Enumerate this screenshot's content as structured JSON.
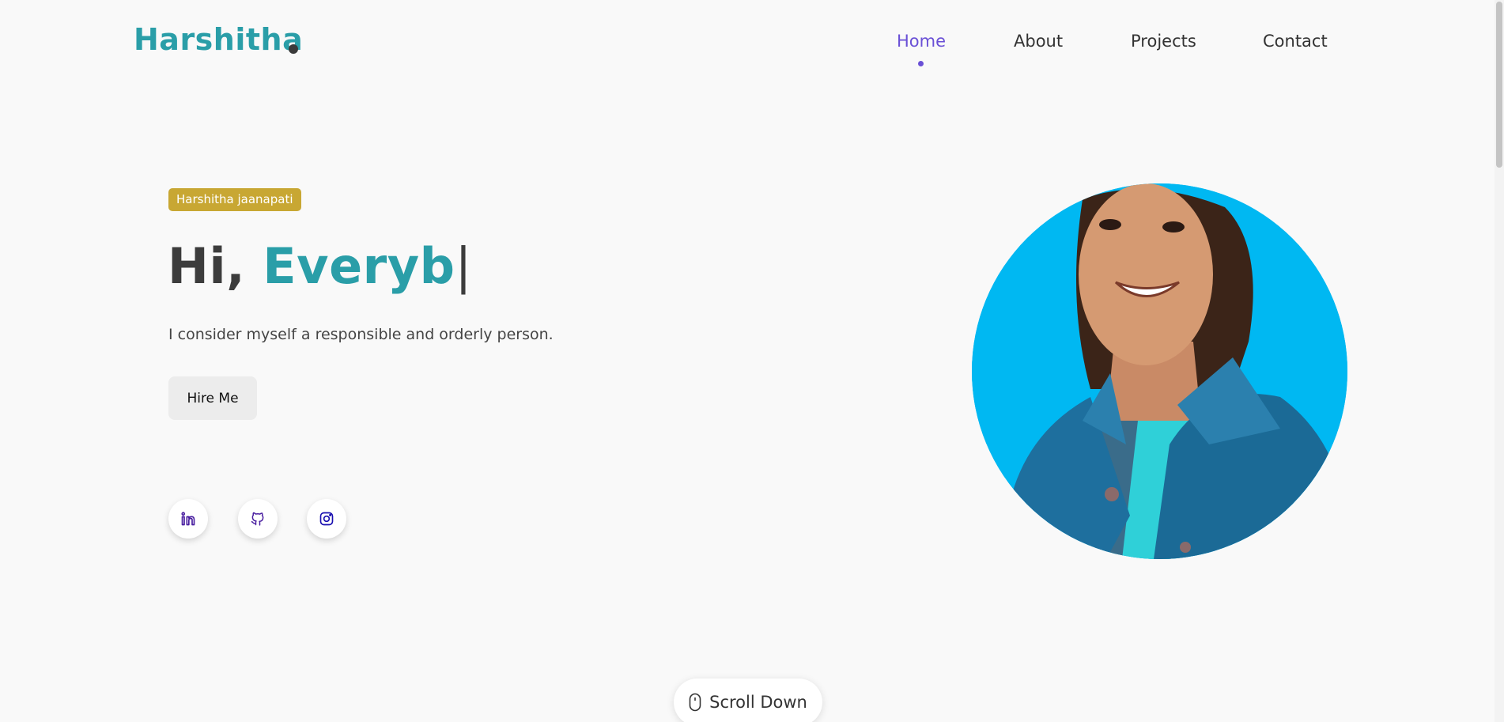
{
  "header": {
    "logo_text": "Harshitha",
    "nav": [
      {
        "label": "Home",
        "active": true
      },
      {
        "label": "About",
        "active": false
      },
      {
        "label": "Projects",
        "active": false
      },
      {
        "label": "Contact",
        "active": false
      }
    ]
  },
  "hero": {
    "badge": "Harshitha jaanapati",
    "greeting": "Hi,",
    "typed_word": "Everyb",
    "caret": "|",
    "tagline": "I consider myself a responsible and orderly person.",
    "cta_label": "Hire Me"
  },
  "socials": [
    {
      "icon": "linkedin-icon"
    },
    {
      "icon": "github-icon"
    },
    {
      "icon": "instagram-icon"
    }
  ],
  "scroll": {
    "label": "Scroll Down",
    "icon": "mouse-icon"
  },
  "colors": {
    "accent": "#2a9ea8",
    "nav_active": "#6a50d6",
    "badge": "#c8a733",
    "portrait_bg": "#00b6f0"
  }
}
